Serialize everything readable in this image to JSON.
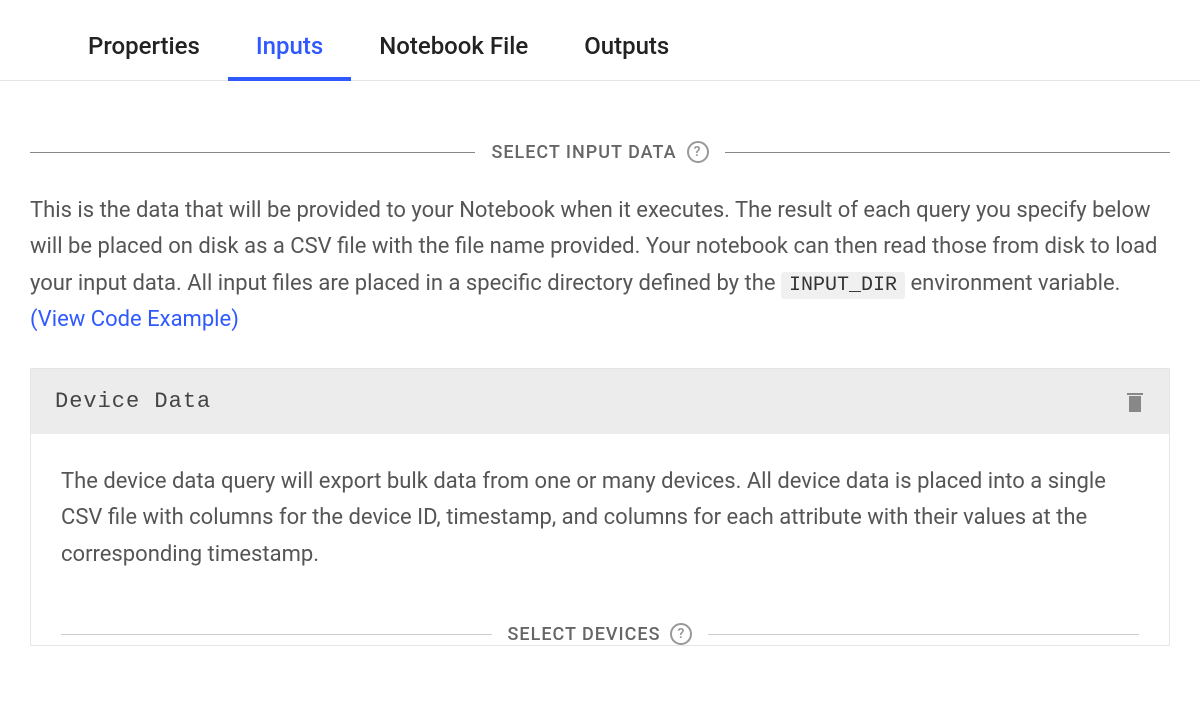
{
  "tabs": {
    "properties": "Properties",
    "inputs": "Inputs",
    "notebook_file": "Notebook File",
    "outputs": "Outputs"
  },
  "section": {
    "select_input_data": "SELECT INPUT DATA",
    "description_part1": "This is the data that will be provided to your Notebook when it executes. The result of each query you specify below will be placed on disk as a CSV file with the file name provided. Your notebook can then read those from disk to load your input data. All input files are placed in a specific directory defined by the ",
    "code_env": "INPUT_DIR",
    "description_part2": " environment variable. ",
    "link_text": "(View Code Example)"
  },
  "card": {
    "title": "Device Data",
    "description": "The device data query will export bulk data from one or many devices. All device data is placed into a single CSV file with columns for the device ID, timestamp, and columns for each attribute with their values at the corresponding timestamp.",
    "select_devices": "SELECT DEVICES"
  },
  "help_glyph": "?"
}
